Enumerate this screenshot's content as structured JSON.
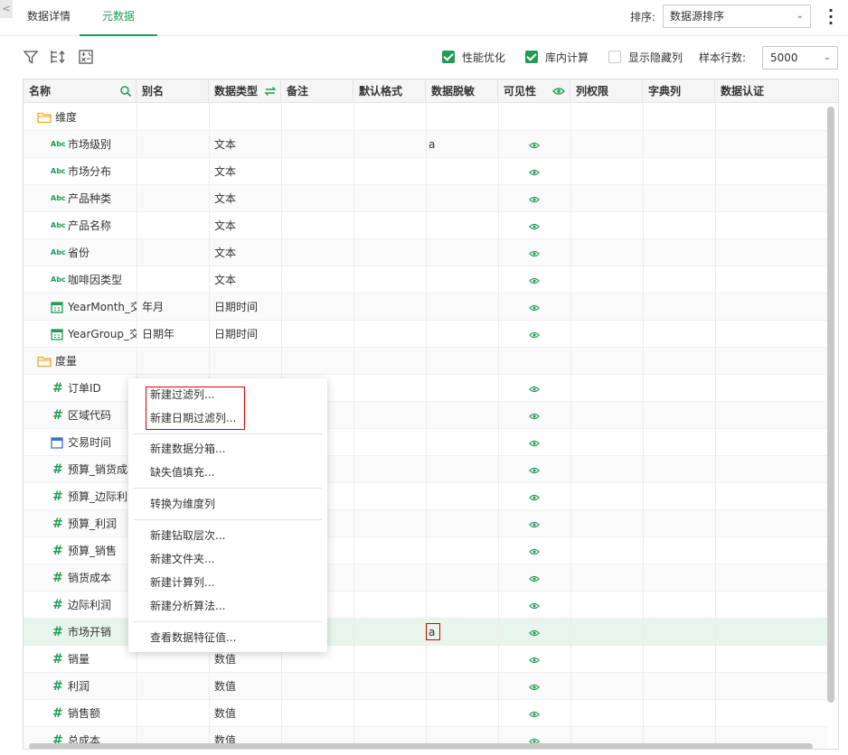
{
  "tabs": {
    "detail": "数据详情",
    "metadata": "元数据"
  },
  "sort": {
    "label": "排序:",
    "value": "数据源排序"
  },
  "toolbar": {
    "performance": "性能优化",
    "in_db_calc": "库内计算",
    "show_hidden": "显示隐藏列",
    "sample_rows_label": "样本行数:",
    "sample_rows_value": "5000"
  },
  "columns": [
    "名称",
    "别名",
    "数据类型",
    "备注",
    "默认格式",
    "数据脱敏",
    "可见性",
    "列权限",
    "字典列",
    "数据认证"
  ],
  "rows": [
    {
      "kind": "folder",
      "name": "维度"
    },
    {
      "kind": "text",
      "name": "市场级别",
      "alias": "",
      "type": "文本",
      "mask": "a"
    },
    {
      "kind": "text",
      "name": "市场分布",
      "alias": "",
      "type": "文本",
      "mask": ""
    },
    {
      "kind": "text",
      "name": "产品种类",
      "alias": "",
      "type": "文本",
      "mask": ""
    },
    {
      "kind": "text",
      "name": "产品名称",
      "alias": "",
      "type": "文本",
      "mask": ""
    },
    {
      "kind": "text",
      "name": "省份",
      "alias": "",
      "type": "文本",
      "mask": ""
    },
    {
      "kind": "text",
      "name": "咖啡因类型",
      "alias": "",
      "type": "文本",
      "mask": ""
    },
    {
      "kind": "date",
      "name": "YearMonth_交",
      "alias": "年月",
      "type": "日期时间",
      "mask": ""
    },
    {
      "kind": "date",
      "name": "YearGroup_交!",
      "alias": "日期年",
      "type": "日期时间",
      "mask": ""
    },
    {
      "kind": "folder",
      "name": "度量"
    },
    {
      "kind": "num",
      "name": "订单ID",
      "alias": "",
      "type": "",
      "mask": ""
    },
    {
      "kind": "num",
      "name": "区域代码",
      "alias": "",
      "type": "",
      "mask": ""
    },
    {
      "kind": "time",
      "name": "交易时间",
      "alias": "",
      "type": "",
      "mask": ""
    },
    {
      "kind": "num",
      "name": "预算_销货成本",
      "alias": "",
      "type": "",
      "mask": ""
    },
    {
      "kind": "num",
      "name": "预算_边际利润",
      "alias": "",
      "type": "",
      "mask": ""
    },
    {
      "kind": "num",
      "name": "预算_利润",
      "alias": "",
      "type": "",
      "mask": ""
    },
    {
      "kind": "num",
      "name": "预算_销售",
      "alias": "",
      "type": "",
      "mask": ""
    },
    {
      "kind": "num",
      "name": "销货成本",
      "alias": "",
      "type": "",
      "mask": ""
    },
    {
      "kind": "num",
      "name": "边际利润",
      "alias": "",
      "type": "",
      "mask": ""
    },
    {
      "kind": "num",
      "name": "市场开销",
      "alias": "",
      "type": "",
      "mask": "a",
      "selected": true
    },
    {
      "kind": "num",
      "name": "销量",
      "alias": "",
      "type": "数值",
      "mask": ""
    },
    {
      "kind": "num",
      "name": "利润",
      "alias": "",
      "type": "数值",
      "mask": ""
    },
    {
      "kind": "num",
      "name": "销售额",
      "alias": "",
      "type": "数值",
      "mask": ""
    },
    {
      "kind": "num",
      "name": "总成本",
      "alias": "",
      "type": "数值",
      "mask": ""
    }
  ],
  "menu": [
    "新建过滤列...",
    "新建日期过滤列...",
    "新建数据分箱...",
    "缺失值填充...",
    "转换为维度列",
    "新建钻取层次...",
    "新建文件夹...",
    "新建计算列...",
    "新建分析算法...",
    "查看数据特征值..."
  ],
  "colors": {
    "accent": "#1f9d55",
    "folder": "#f5a623",
    "highlight": "#d00000"
  },
  "icons": {
    "toolbar": [
      "filter-icon",
      "sort-columns-icon",
      "calculator-icon"
    ],
    "search": "search-icon",
    "swap": "swap-icon",
    "eye": "eye-icon",
    "folder": "folder-icon",
    "text": "abc-icon",
    "number": "hash-icon",
    "date": "calendar-icon"
  }
}
